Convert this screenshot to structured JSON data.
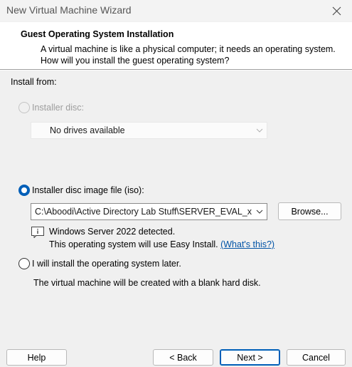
{
  "window": {
    "title": "New Virtual Machine Wizard",
    "close_icon": "close-icon"
  },
  "header": {
    "title": "Guest Operating System Installation",
    "description": "A virtual machine is like a physical computer; it needs an operating system. How will you install the guest operating system?"
  },
  "install_from_label": "Install from:",
  "options": {
    "disc": {
      "label": "Installer disc:",
      "selected": false,
      "enabled": false,
      "dropdown_value": "No drives available"
    },
    "iso": {
      "label": "Installer disc image file (iso):",
      "selected": true,
      "enabled": true,
      "path_value": "C:\\Aboodi\\Active Directory Lab Stuff\\SERVER_EVAL_x",
      "browse_label": "Browse...",
      "detected_text": "Windows Server 2022 detected.",
      "easy_install_text": "This operating system will use Easy Install.",
      "whats_this_link": "(What's this?)"
    },
    "later": {
      "label": "I will install the operating system later.",
      "selected": false,
      "enabled": true,
      "description": "The virtual machine will be created with a blank hard disk."
    }
  },
  "footer": {
    "help_label": "Help",
    "back_label": "< Back",
    "next_label": "Next >",
    "cancel_label": "Cancel"
  },
  "colors": {
    "accent": "#005fb8",
    "link": "#0053a6"
  }
}
